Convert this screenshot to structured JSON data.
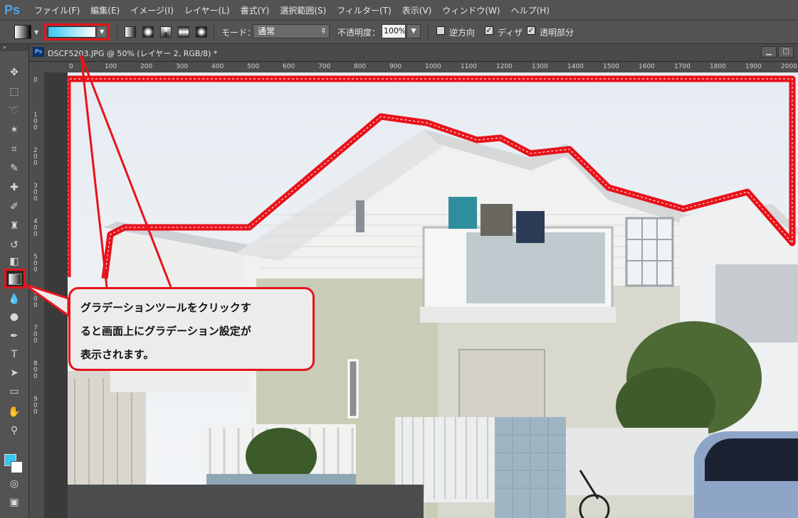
{
  "app": {
    "logo": "Ps"
  },
  "menu": [
    "ファイル(F)",
    "編集(E)",
    "イメージ(I)",
    "レイヤー(L)",
    "書式(Y)",
    "選択範囲(S)",
    "フィルター(T)",
    "表示(V)",
    "ウィンドウ(W)",
    "ヘルプ(H)"
  ],
  "options": {
    "mode_label": "モード：",
    "mode_value": "通常",
    "opacity_label": "不透明度：",
    "opacity_value": "100%",
    "reverse_label": "逆方向",
    "reverse_checked": false,
    "dither_label": "ディザ",
    "dither_checked": true,
    "transparency_label": "透明部分",
    "transparency_checked": true,
    "gradient_colors": [
      "#35c6f2",
      "#ffffff"
    ]
  },
  "document": {
    "ps_icon": "Ps",
    "title": "DSCF5203.JPG @ 50% (レイヤー 2, RGB/8) *",
    "minimize": "▁",
    "restore": "□",
    "close": "✕"
  },
  "ruler": {
    "h": [
      "0",
      "100",
      "200",
      "300",
      "400",
      "500",
      "600",
      "700",
      "800",
      "900",
      "1000",
      "1100",
      "1200",
      "1300",
      "1400",
      "1500",
      "1600",
      "1700",
      "1800",
      "1900",
      "2000"
    ],
    "v": [
      "0",
      "1",
      "0",
      "0",
      "2",
      "0",
      "0",
      "3",
      "0",
      "0",
      "4",
      "0",
      "0",
      "5",
      "0",
      "0",
      "6",
      "0",
      "0",
      "7",
      "0",
      "0",
      "8",
      "0",
      "0",
      "9",
      "0",
      "0"
    ]
  },
  "colors": {
    "foreground": "#35c6f2",
    "background": "#ffffff",
    "highlight": "#e8121a"
  },
  "callout": {
    "lines": [
      "グラデーションツールをクリックす",
      "ると画面上にグラデーション設定が",
      "表示されます。"
    ]
  }
}
